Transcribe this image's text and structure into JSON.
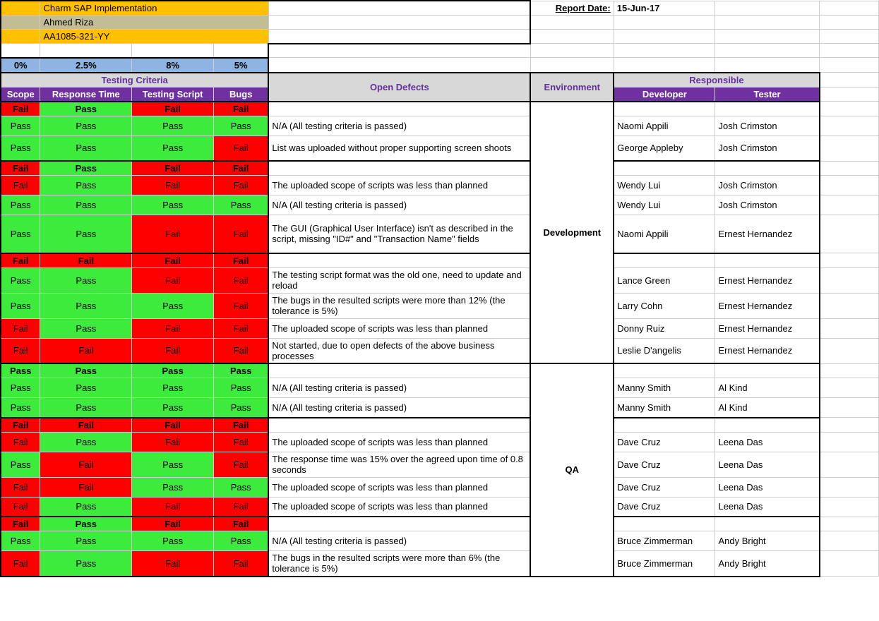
{
  "header": {
    "project": "Charm SAP Implementation",
    "owner": "Ahmed Riza",
    "code": "AA1085-321-YY",
    "report_date_label": "Report Date:",
    "report_date": "15-Jun-17"
  },
  "percent_row": [
    "0%",
    "2.5%",
    "8%",
    "5%"
  ],
  "section_headers": {
    "testing_criteria": "Testing Criteria",
    "open_defects": "Open Defects",
    "environment": "Environment",
    "responsible": "Responsible"
  },
  "col_headers": {
    "scope": "Scope",
    "response_time": "Response Time",
    "testing_script": "Testing Script",
    "bugs": "Bugs",
    "developer": "Developer",
    "tester": "Tester"
  },
  "env": {
    "dev": "Development",
    "qa": "QA"
  },
  "rows": [
    {
      "s": "Fail",
      "r": "Pass",
      "t": "Fail",
      "b": "Fail",
      "defect": "",
      "dev": "",
      "test": "",
      "head": true
    },
    {
      "s": "Pass",
      "r": "Pass",
      "t": "Pass",
      "b": "Pass",
      "defect": "N/A (All testing criteria is passed)",
      "dev": "Naomi Appili",
      "test": "Josh Crimston"
    },
    {
      "s": "Pass",
      "r": "Pass",
      "t": "Pass",
      "b": "Fail",
      "defect": "List was uploaded without proper supporting screen shoots",
      "dev": "George Appleby",
      "test": "Josh Crimston",
      "tall": true
    },
    {
      "s": "Fail",
      "r": "Pass",
      "t": "Fail",
      "b": "Fail",
      "defect": "",
      "dev": "",
      "test": "",
      "head": true
    },
    {
      "s": "Fail",
      "r": "Pass",
      "t": "Fail",
      "b": "Fail",
      "defect": "The uploaded scope of scripts was less than planned",
      "dev": "Wendy Lui",
      "test": "Josh Crimston"
    },
    {
      "s": "Pass",
      "r": "Pass",
      "t": "Pass",
      "b": "Pass",
      "defect": "N/A (All testing criteria is passed)",
      "dev": "Wendy Lui",
      "test": "Josh Crimston"
    },
    {
      "s": "Pass",
      "r": "Pass",
      "t": "Fail",
      "b": "Fail",
      "defect": "The GUI (Graphical User Interface) isn't as described in the script, missing \"ID#\" and \"Transaction Name\" fields",
      "dev": "Naomi Appili",
      "test": "Ernest Hernandez",
      "tall3": true
    },
    {
      "s": "Fail",
      "r": "Fail",
      "t": "Fail",
      "b": "Fail",
      "defect": "",
      "dev": "",
      "test": "",
      "head": true
    },
    {
      "s": "Pass",
      "r": "Pass",
      "t": "Fail",
      "b": "Fail",
      "defect": "The testing script format was the old one, need to update and reload",
      "dev": "Lance Green",
      "test": "Ernest Hernandez",
      "tall": true
    },
    {
      "s": "Pass",
      "r": "Pass",
      "t": "Pass",
      "b": "Fail",
      "defect": "The bugs in the resulted scripts were more than 12% (the tolerance is 5%)",
      "dev": "Larry Cohn",
      "test": "Ernest Hernandez",
      "tall": true
    },
    {
      "s": "Fail",
      "r": "Pass",
      "t": "Fail",
      "b": "Fail",
      "defect": "The uploaded scope of scripts was less than planned",
      "dev": "Donny Ruiz",
      "test": "Ernest Hernandez"
    },
    {
      "s": "Fail",
      "r": "Fail",
      "t": "Fail",
      "b": "Fail",
      "defect": "Not started, due to open defects of the above business processes",
      "dev": "Leslie D'angelis",
      "test": "Ernest Hernandez",
      "tall": true
    },
    {
      "s": "Pass",
      "r": "Pass",
      "t": "Pass",
      "b": "Pass",
      "defect": "",
      "dev": "",
      "test": "",
      "head": true,
      "qa_start": true
    },
    {
      "s": "Pass",
      "r": "Pass",
      "t": "Pass",
      "b": "Pass",
      "defect": "N/A (All testing criteria is passed)",
      "dev": "Manny Smith",
      "test": "Al Kind"
    },
    {
      "s": "Pass",
      "r": "Pass",
      "t": "Pass",
      "b": "Pass",
      "defect": "N/A (All testing criteria is passed)",
      "dev": "Manny Smith",
      "test": "Al Kind"
    },
    {
      "s": "Fail",
      "r": "Fail",
      "t": "Fail",
      "b": "Fail",
      "defect": "",
      "dev": "",
      "test": "",
      "head": true
    },
    {
      "s": "Fail",
      "r": "Pass",
      "t": "Fail",
      "b": "Fail",
      "defect": "The uploaded scope of scripts was less than planned",
      "dev": "Dave Cruz",
      "test": "Leena Das"
    },
    {
      "s": "Pass",
      "r": "Fail",
      "t": "Pass",
      "b": "Fail",
      "defect": "The response time was 15% over the agreed upon time of 0.8 seconds",
      "dev": "Dave Cruz",
      "test": "Leena Das",
      "tall": true
    },
    {
      "s": "Fail",
      "r": "Fail",
      "t": "Pass",
      "b": "Pass",
      "defect": "The uploaded scope of scripts was less than planned",
      "dev": "Dave Cruz",
      "test": "Leena Das"
    },
    {
      "s": "Fail",
      "r": "Pass",
      "t": "Fail",
      "b": "Fail",
      "defect": "The uploaded scope of scripts was less than planned",
      "dev": "Dave Cruz",
      "test": "Leena Das"
    },
    {
      "s": "Fail",
      "r": "Pass",
      "t": "Fail",
      "b": "Fail",
      "defect": "",
      "dev": "",
      "test": "",
      "head": true
    },
    {
      "s": "Pass",
      "r": "Pass",
      "t": "Pass",
      "b": "Pass",
      "defect": "N/A (All testing criteria is passed)",
      "dev": "Bruce Zimmerman",
      "test": "Andy Bright"
    },
    {
      "s": "Fail",
      "r": "Pass",
      "t": "Fail",
      "b": "Fail",
      "defect": "The bugs in the resulted scripts were more than 6% (the tolerance is 5%)",
      "dev": "Bruce Zimmerman",
      "test": "Andy Bright",
      "tall": true
    }
  ]
}
